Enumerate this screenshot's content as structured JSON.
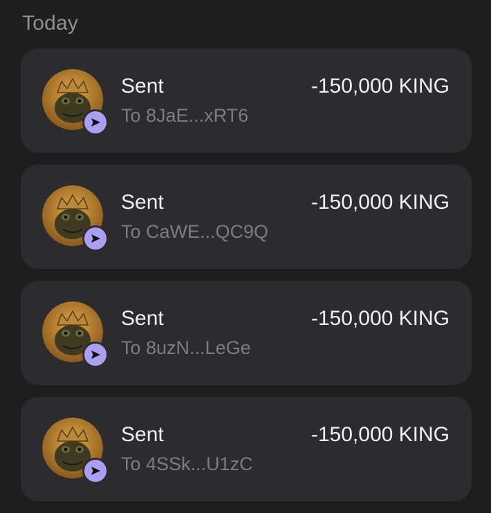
{
  "section": {
    "title": "Today"
  },
  "transactions": [
    {
      "title": "Sent",
      "subtitle": "To 8JaE...xRT6",
      "amount": "-150,000 KING",
      "token_icon": "king-frog-token-icon",
      "badge_icon": "send-arrow-icon"
    },
    {
      "title": "Sent",
      "subtitle": "To CaWE...QC9Q",
      "amount": "-150,000 KING",
      "token_icon": "king-frog-token-icon",
      "badge_icon": "send-arrow-icon"
    },
    {
      "title": "Sent",
      "subtitle": "To 8uzN...LeGe",
      "amount": "-150,000 KING",
      "token_icon": "king-frog-token-icon",
      "badge_icon": "send-arrow-icon"
    },
    {
      "title": "Sent",
      "subtitle": "To 4SSk...U1zC",
      "amount": "-150,000 KING",
      "token_icon": "king-frog-token-icon",
      "badge_icon": "send-arrow-icon"
    }
  ],
  "colors": {
    "background": "#1e1e1e",
    "card": "#2c2c2e",
    "badge": "#ab9ff2",
    "primary_text": "#f2f2f2",
    "secondary_text": "#7d7d7d",
    "header_text": "#8f8f8f"
  }
}
